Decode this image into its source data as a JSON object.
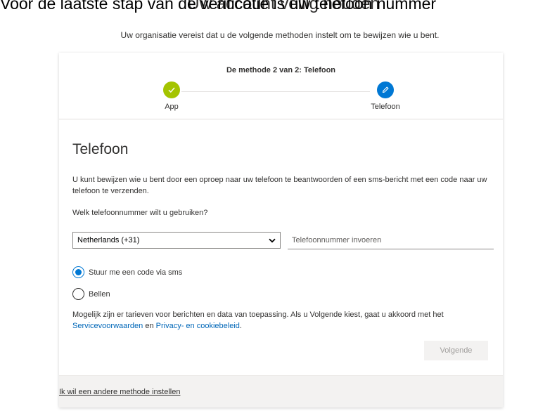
{
  "caption": "Voor de laatste stap van de verificatie is uw telefoon nummer",
  "page": {
    "heading": "Uw account veilig houden",
    "subtext": "Uw organisatie vereist dat u de volgende methoden instelt om te bewijzen wie u bent."
  },
  "stepper": {
    "title": "De methode 2 van 2: Telefoon",
    "steps": [
      {
        "label": "App",
        "status": "completed",
        "icon": "check-icon",
        "color": "#a4c400"
      },
      {
        "label": "Telefoon",
        "status": "current",
        "icon": "pencil-icon",
        "color": "#0078d4"
      }
    ]
  },
  "phone": {
    "title": "Telefoon",
    "description": "U kunt bewijzen wie u bent door een oproep naar uw telefoon te beantwoorden of een sms-bericht met een code naar uw telefoon te verzenden.",
    "question": "Welk telefoonnummer wilt u gebruiken?",
    "country_selected": "Netherlands (+31)",
    "phone_placeholder": "Telefoonnummer invoeren",
    "phone_value": "",
    "options": [
      {
        "label": "Stuur me een code via sms",
        "checked": true
      },
      {
        "label": "Bellen",
        "checked": false
      }
    ],
    "legal_text": "Mogelijk zijn er tarieven voor berichten en data van toepassing. Als u Volgende kiest, gaat u akkoord met het",
    "terms_link": "Servicevoorwaarden",
    "and_text": "en",
    "privacy_link": "Privacy- en cookiebeleid",
    "period": ".",
    "next_label": "Volgende"
  },
  "footer": {
    "other_method_link": "Ik wil een andere methode instellen"
  },
  "colors": {
    "accent": "#0078d4",
    "success": "#a4c400",
    "link": "#0067b8"
  }
}
